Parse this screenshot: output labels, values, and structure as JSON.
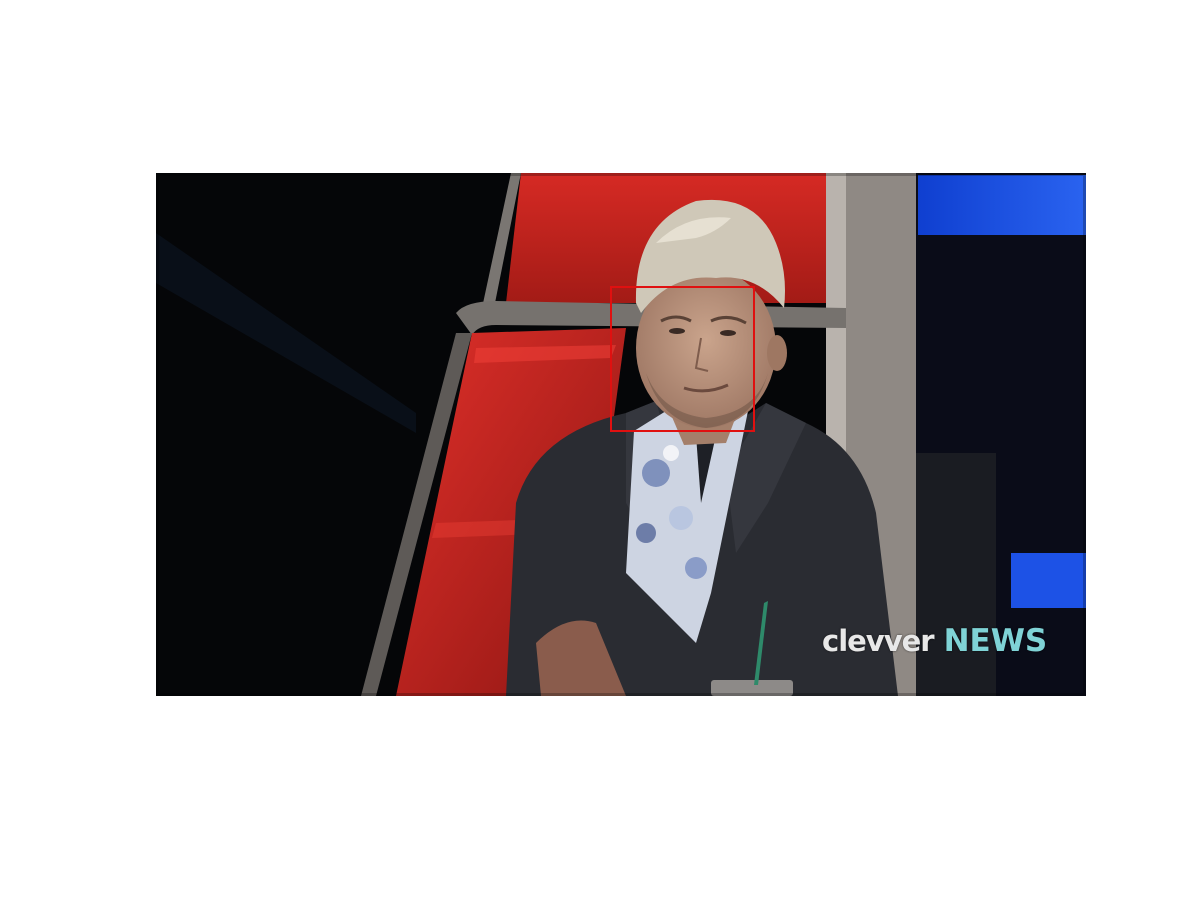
{
  "watermark": {
    "brand": "clevver",
    "tag": "NEWS"
  },
  "colors": {
    "background": "#ffffff",
    "chair_red": "#c8241e",
    "chair_frame": "#6e6a66",
    "annotation_box": "#e01010",
    "stage_blue": "#1a4fd8",
    "watermark_accent": "#7fd3d6"
  }
}
